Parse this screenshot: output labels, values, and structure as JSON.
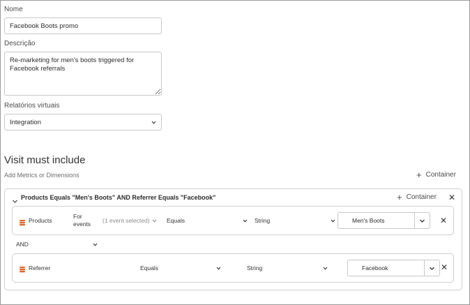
{
  "form": {
    "name_label": "Nome",
    "name_value": "Facebook Boots promo",
    "description_label": "Descrição",
    "description_value": "Re-marketing for men's boots triggered for Facebook referrals",
    "virtual_reports_label": "Relatórios virtuais",
    "virtual_reports_value": "Integration"
  },
  "segment": {
    "heading": "Visit must include",
    "subheading": "Add Metrics or Dimensions",
    "add_container_label": "Container",
    "container": {
      "title": "Products Equals \"Men's Boots\" AND Referrer Equals \"Facebook\"",
      "add_container_label": "Container",
      "rules": [
        {
          "dimension": "Products",
          "for_events_label": "For events",
          "events_selector": "(1 event selected)",
          "operator": "Equals",
          "type": "String",
          "value": "Men's Boots"
        },
        {
          "dimension": "Referrer",
          "operator": "Equals",
          "type": "String",
          "value": "Facebook"
        }
      ],
      "logic_operator": "AND"
    }
  },
  "colors": {
    "dimension_icon": "#e8641c",
    "border": "#c8c8c8"
  },
  "icons": {
    "chevron": "chevron-down-icon",
    "plus": "plus-icon",
    "close": "close-icon",
    "dimension": "dimension-icon"
  }
}
